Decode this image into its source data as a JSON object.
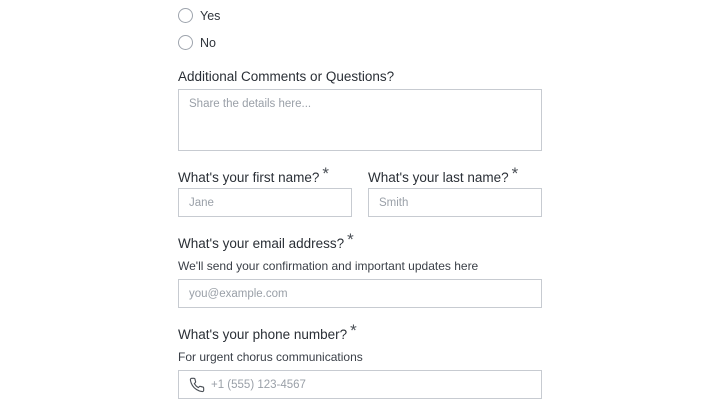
{
  "consent_options": {
    "yes_label": "Yes",
    "no_label": "No"
  },
  "comments": {
    "label": "Additional Comments or Questions?",
    "placeholder": "Share the details here..."
  },
  "first_name": {
    "label": "What's your first name?",
    "required_mark": "*",
    "placeholder": "Jane"
  },
  "last_name": {
    "label": "What's your last name?",
    "required_mark": "*",
    "placeholder": "Smith"
  },
  "email": {
    "label": "What's your email address?",
    "required_mark": "*",
    "help": "We'll send your confirmation and important updates here",
    "placeholder": "you@example.com"
  },
  "phone": {
    "label": "What's your phone number?",
    "required_mark": "*",
    "help": "For urgent chorus communications",
    "placeholder": "+1 (555) 123-4567",
    "icon": "phone-icon"
  },
  "colors": {
    "border": "#c7cbd1",
    "text": "#2a2f36",
    "placeholder": "#9aa0a8"
  }
}
